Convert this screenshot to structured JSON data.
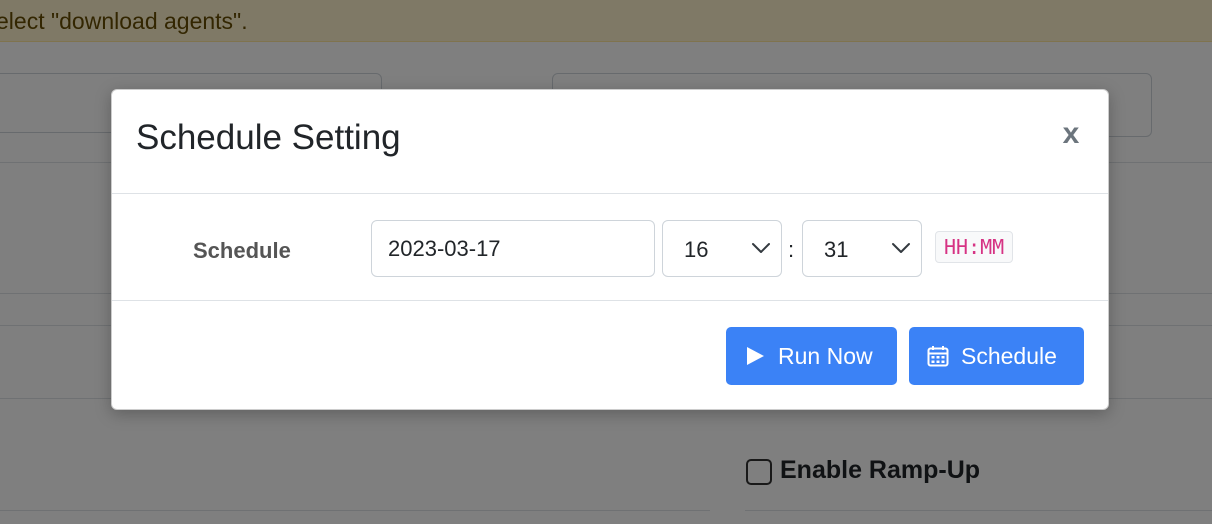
{
  "background": {
    "alert_text": "elect \"download agents\".",
    "ramp_up_label": "Enable Ramp-Up"
  },
  "modal": {
    "title": "Schedule Setting",
    "close_label": "x",
    "schedule_label": "Schedule",
    "date_value": "2023-03-17",
    "hour_value": "16",
    "minute_value": "31",
    "separator": ":",
    "format_hint": "HH:MM",
    "run_now_label": "Run Now",
    "schedule_button_label": "Schedule",
    "icons": {
      "run": "play-icon",
      "schedule": "calendar-icon"
    }
  },
  "colors": {
    "primary_button": "#3b82f6",
    "format_hint_text": "#d63384",
    "alert_background": "#fff3cd"
  }
}
